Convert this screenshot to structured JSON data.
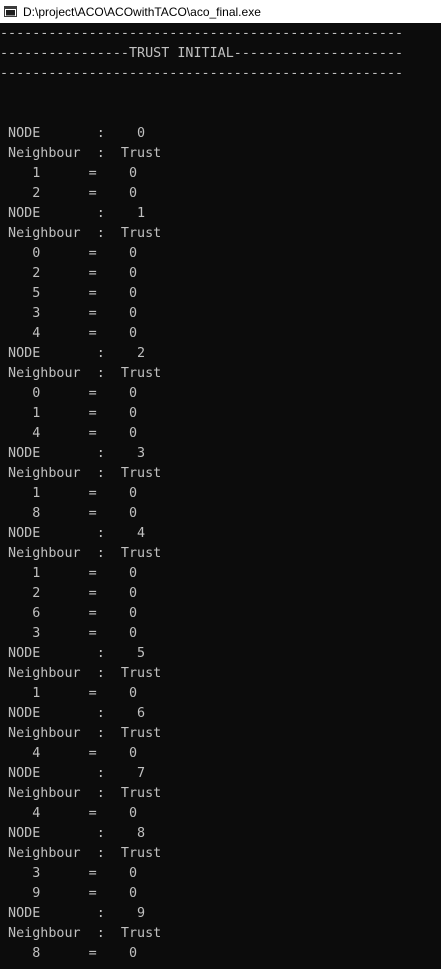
{
  "window": {
    "title": "D:\\project\\ACO\\ACOwithTACO\\aco_final.exe"
  },
  "console": {
    "lines": [
      "--------------------------------------------------",
      "----------------TRUST INITIAL---------------------",
      "--------------------------------------------------",
      "",
      "",
      " NODE       :    0",
      " Neighbour  :  Trust",
      "    1      =    0",
      "    2      =    0",
      " NODE       :    1",
      " Neighbour  :  Trust",
      "    0      =    0",
      "    2      =    0",
      "    5      =    0",
      "    3      =    0",
      "    4      =    0",
      " NODE       :    2",
      " Neighbour  :  Trust",
      "    0      =    0",
      "    1      =    0",
      "    4      =    0",
      " NODE       :    3",
      " Neighbour  :  Trust",
      "    1      =    0",
      "    8      =    0",
      " NODE       :    4",
      " Neighbour  :  Trust",
      "    1      =    0",
      "    2      =    0",
      "    6      =    0",
      "    3      =    0",
      " NODE       :    5",
      " Neighbour  :  Trust",
      "    1      =    0",
      " NODE       :    6",
      " Neighbour  :  Trust",
      "    4      =    0",
      " NODE       :    7",
      " Neighbour  :  Trust",
      "    4      =    0",
      " NODE       :    8",
      " Neighbour  :  Trust",
      "    3      =    0",
      "    9      =    0",
      " NODE       :    9",
      " Neighbour  :  Trust",
      "    8      =    0"
    ]
  }
}
